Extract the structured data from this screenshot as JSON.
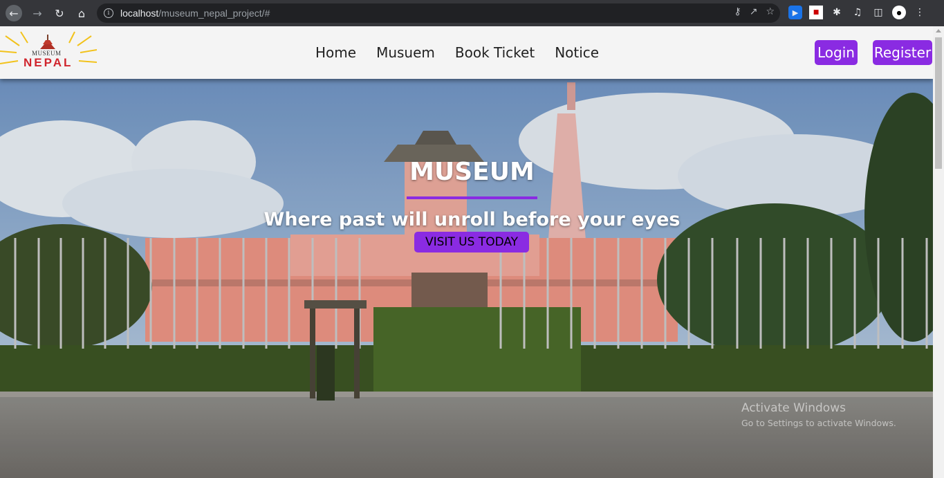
{
  "browser": {
    "url_host": "localhost",
    "url_path": "/museum_nepal_project/#"
  },
  "logo": {
    "top_text": "MUSEUM",
    "main_text": "NEPAL"
  },
  "nav": {
    "items": [
      {
        "label": "Home"
      },
      {
        "label": "Musuem"
      },
      {
        "label": "Book Ticket"
      },
      {
        "label": "Notice"
      }
    ],
    "login_label": "Login",
    "register_label": "Register"
  },
  "hero": {
    "title": "MUSEUM",
    "subtitle": "Where past will unroll before your eyes",
    "cta_label": "VISIT US TODAY"
  },
  "watermark": {
    "title": "Activate Windows",
    "subtitle": "Go to Settings to activate Windows."
  },
  "colors": {
    "accent": "#8a2be2",
    "chrome": "#35363a"
  }
}
